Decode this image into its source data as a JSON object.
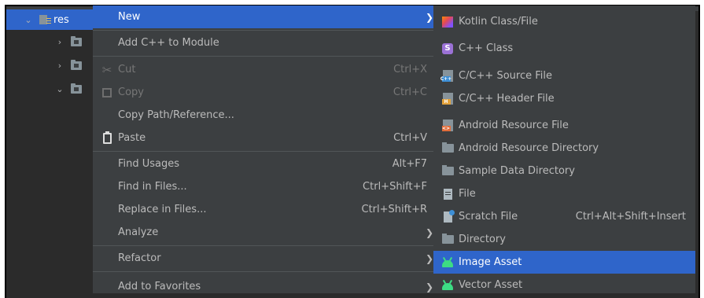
{
  "tree": {
    "selected_label": "res"
  },
  "context_menu": {
    "items": [
      {
        "label": "New",
        "shortcut": ""
      },
      {
        "label": "Add C++ to Module",
        "shortcut": ""
      },
      {
        "label": "Cut",
        "shortcut": "Ctrl+X"
      },
      {
        "label": "Copy",
        "shortcut": "Ctrl+C"
      },
      {
        "label": "Copy Path/Reference...",
        "shortcut": ""
      },
      {
        "label": "Paste",
        "shortcut": "Ctrl+V"
      },
      {
        "label": "Find Usages",
        "shortcut": "Alt+F7"
      },
      {
        "label": "Find in Files...",
        "shortcut": "Ctrl+Shift+F"
      },
      {
        "label": "Replace in Files...",
        "shortcut": "Ctrl+Shift+R"
      },
      {
        "label": "Analyze",
        "shortcut": ""
      },
      {
        "label": "Refactor",
        "shortcut": ""
      },
      {
        "label": "Add to Favorites",
        "shortcut": ""
      }
    ]
  },
  "new_submenu": {
    "items": [
      {
        "label": "Kotlin Class/File",
        "icon": "kotlin-icon"
      },
      {
        "label": "C++ Class",
        "icon": "cpp-class-icon",
        "badge": "S"
      },
      {
        "label": "C/C++ Source File",
        "icon": "cpp-source-file-icon",
        "badge": "C++"
      },
      {
        "label": "C/C++ Header File",
        "icon": "cpp-header-file-icon",
        "badge": "H"
      },
      {
        "label": "Android Resource File",
        "icon": "android-resource-file-icon",
        "badge": "<>"
      },
      {
        "label": "Android Resource Directory",
        "icon": "folder-icon"
      },
      {
        "label": "Sample Data Directory",
        "icon": "folder-icon"
      },
      {
        "label": "File",
        "icon": "file-icon"
      },
      {
        "label": "Scratch File",
        "icon": "scratch-file-icon",
        "shortcut": "Ctrl+Alt+Shift+Insert"
      },
      {
        "label": "Directory",
        "icon": "folder-icon"
      },
      {
        "label": "Image Asset",
        "icon": "android-icon"
      },
      {
        "label": "Vector Asset",
        "icon": "android-icon"
      }
    ]
  },
  "colors": {
    "menu_bg": "#3c3f41",
    "highlight": "#2f65ca",
    "text": "#bbbbbb",
    "disabled_text": "#777777"
  }
}
